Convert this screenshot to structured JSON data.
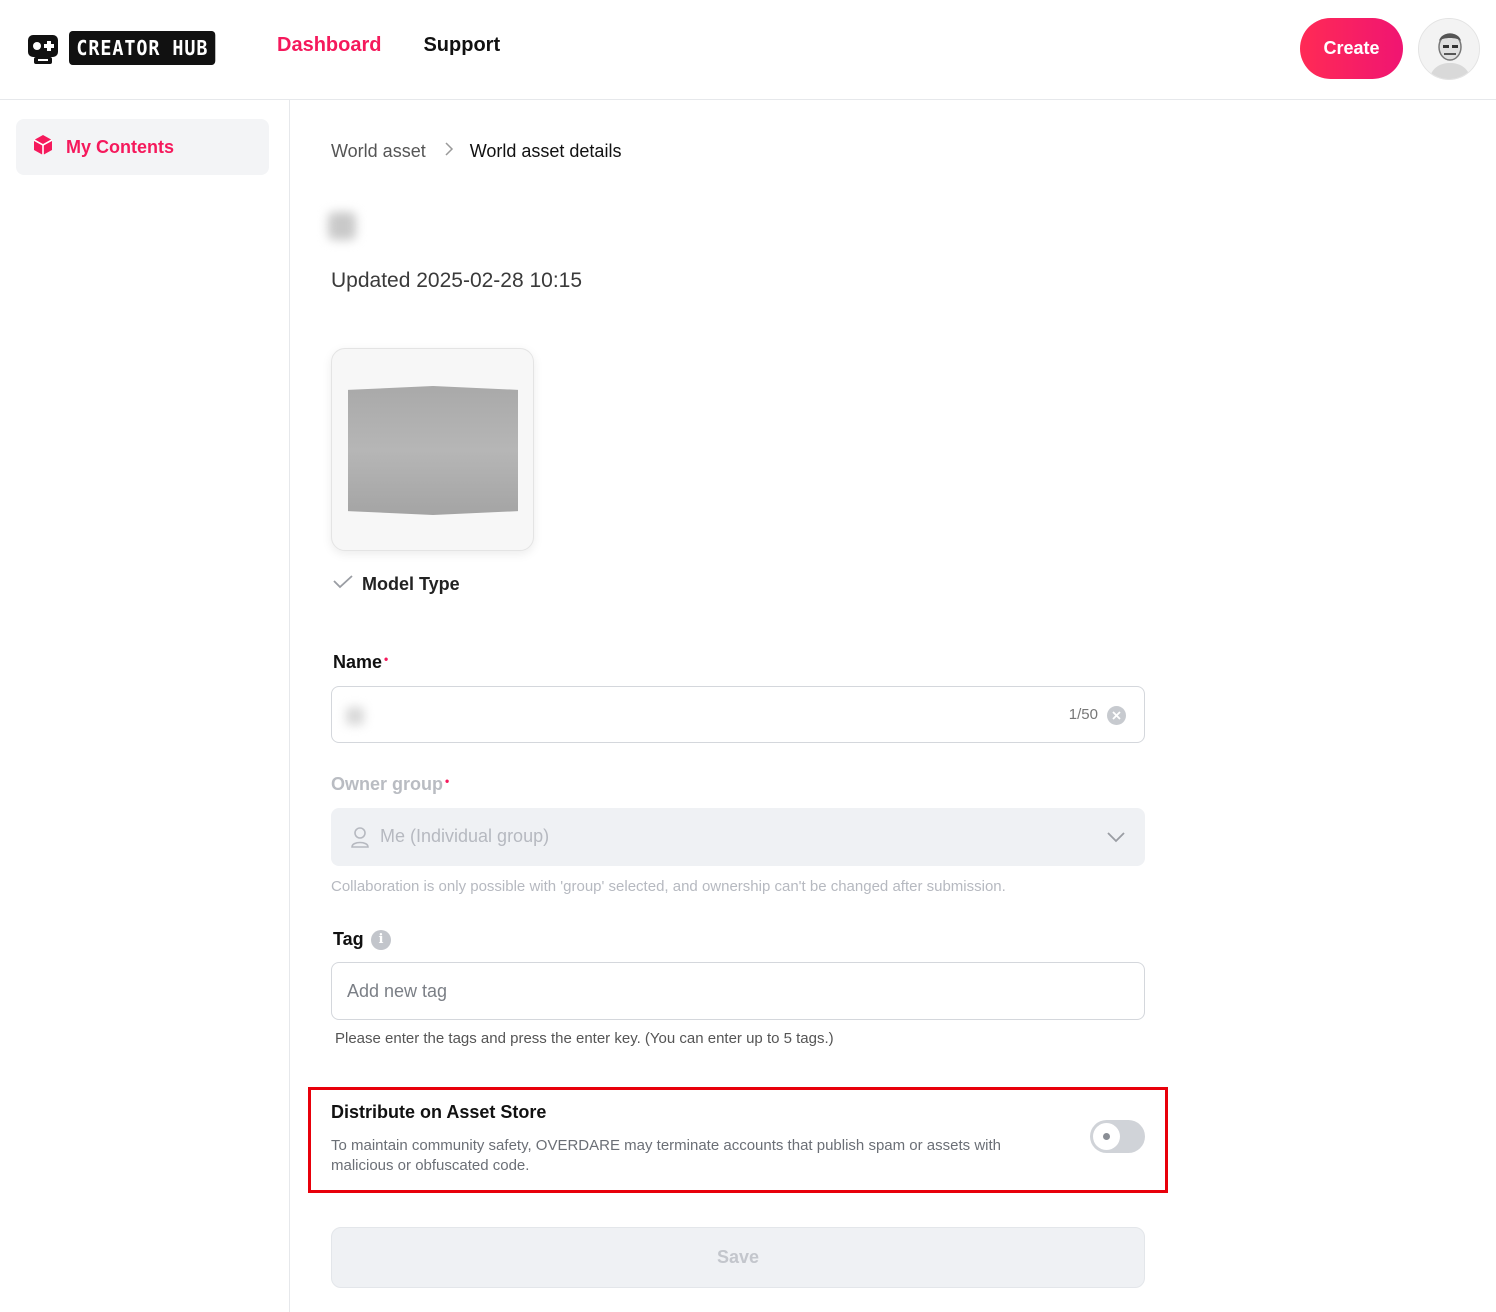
{
  "header": {
    "logo_text": "CREATOR HUB",
    "nav": [
      {
        "label": "Dashboard",
        "active": true
      },
      {
        "label": "Support",
        "active": false
      }
    ],
    "create_label": "Create"
  },
  "sidebar": {
    "items": [
      {
        "label": "My Contents",
        "icon": "cube-icon",
        "active": true
      }
    ]
  },
  "breadcrumb": {
    "parent": "World asset",
    "current": "World asset details"
  },
  "asset": {
    "updated": "Updated 2025-02-28 10:15",
    "model_type_label": "Model Type"
  },
  "form": {
    "name": {
      "label": "Name",
      "required_mark": "•",
      "counter": "1/50"
    },
    "owner_group": {
      "label": "Owner group",
      "required_mark": "•",
      "value": "Me (Individual group)",
      "helper": "Collaboration is only possible with 'group' selected, and ownership can't be changed after submission."
    },
    "tag": {
      "label": "Tag",
      "placeholder": "Add new tag",
      "helper": "Please enter the tags and press the enter key. (You can enter up to 5 tags.)"
    },
    "distribute": {
      "title": "Distribute on Asset Store",
      "description": "To maintain community safety, OVERDARE may terminate accounts that publish spam or assets with malicious or obfuscated code.",
      "enabled": false
    },
    "save_label": "Save"
  },
  "colors": {
    "accent": "#f5195c",
    "highlight_border": "#e8000b"
  }
}
